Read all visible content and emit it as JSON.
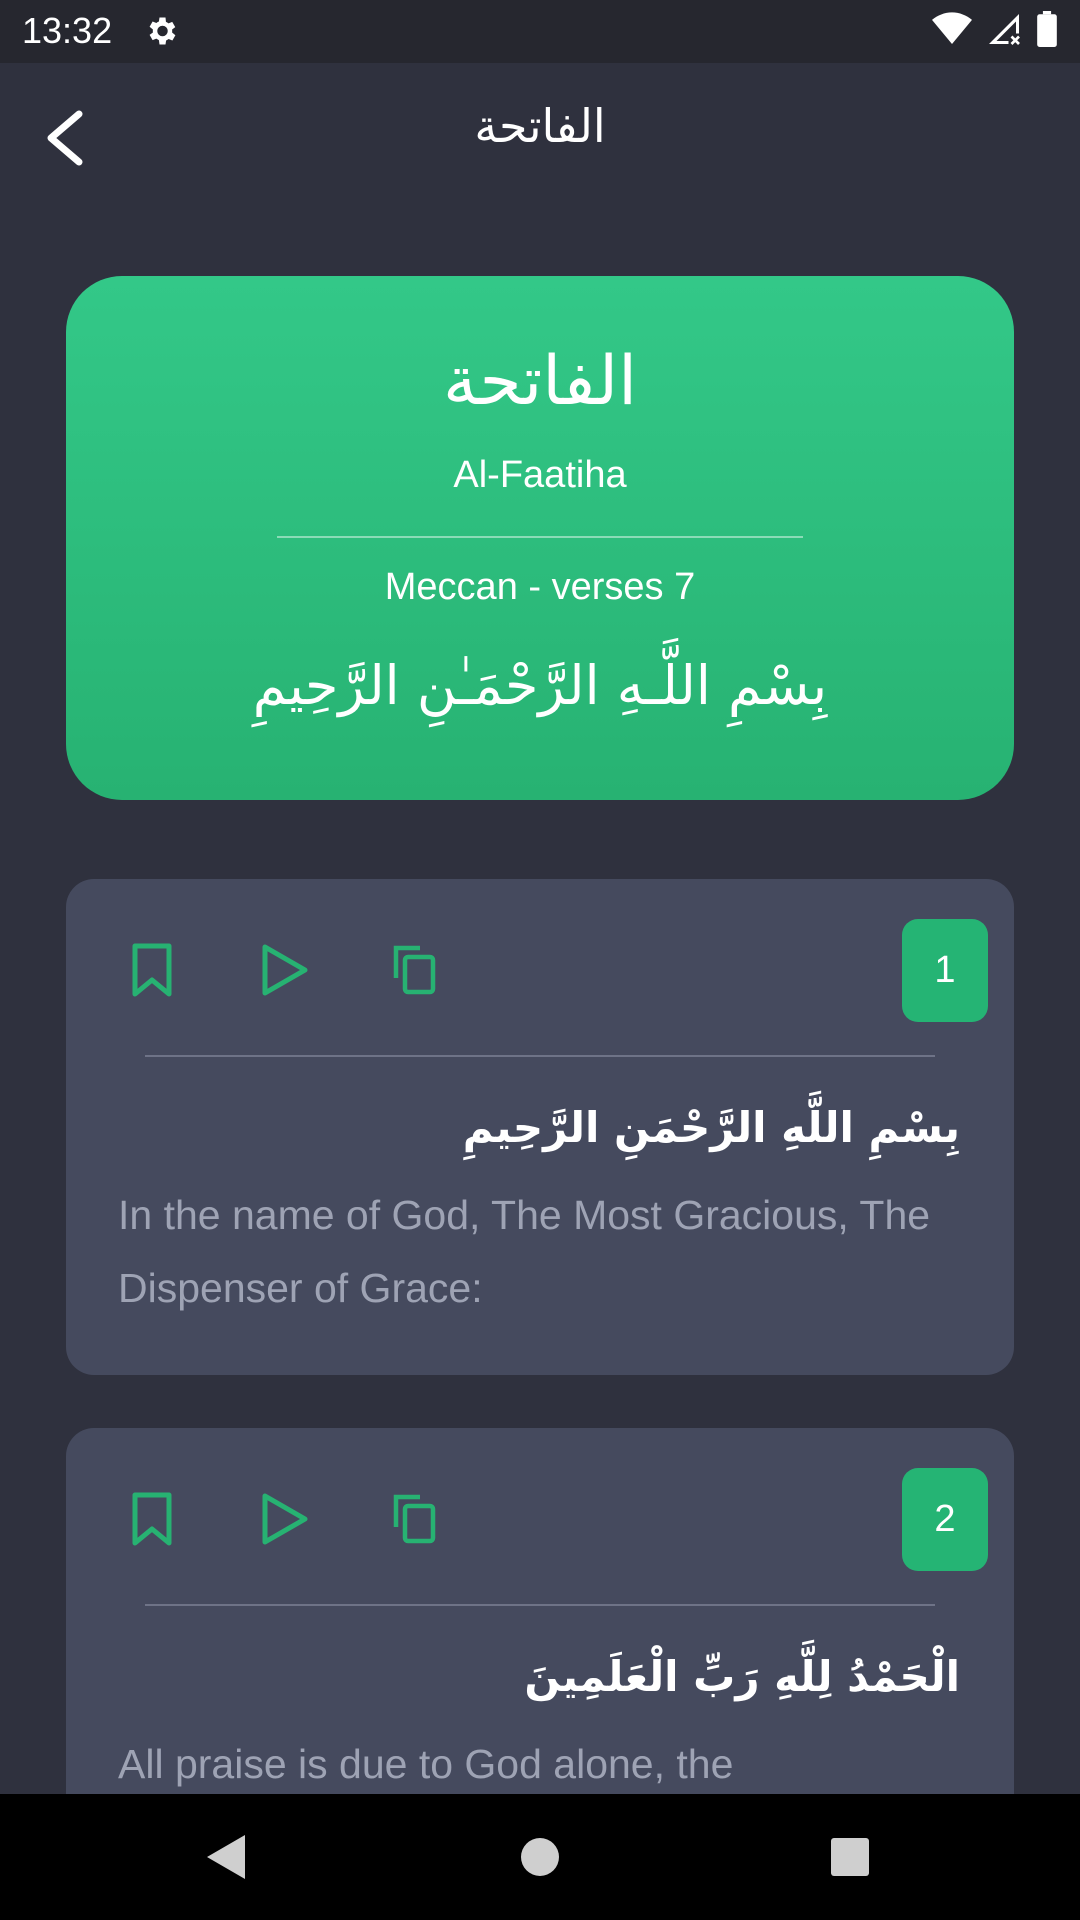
{
  "status_bar": {
    "time": "13:32",
    "icons": [
      "gear-icon",
      "wifi-icon",
      "signal-icon",
      "battery-icon"
    ]
  },
  "app_bar": {
    "title": "الفاتحة",
    "back_icon": "chevron-left-icon"
  },
  "surah": {
    "name_arabic": "الفاتحة",
    "name_latin": "Al-Faatiha",
    "meta": "Meccan - verses 7",
    "basmala": "بِسْمِ اللَّـهِ الرَّحْمَـٰنِ الرَّحِيمِ"
  },
  "verses": [
    {
      "number": "1",
      "arabic": "بِسْمِ اللَّهِ الرَّحْمَنِ الرَّحِيمِ",
      "translation": "In the name of God, The Most Gracious, The Dispenser of Grace:"
    },
    {
      "number": "2",
      "arabic": "الْحَمْدُ لِلَّهِ رَبِّ الْعَلَمِينَ",
      "translation": "All praise is due to God alone, the"
    }
  ],
  "actions": [
    "bookmark-icon",
    "play-icon",
    "copy-icon"
  ],
  "colors": {
    "accent": "#27b272",
    "background": "#2f313e",
    "card": "#454a5e",
    "status_bar": "#26272f"
  },
  "nav_bar": [
    "nav-back-icon",
    "nav-home-icon",
    "nav-recents-icon"
  ]
}
